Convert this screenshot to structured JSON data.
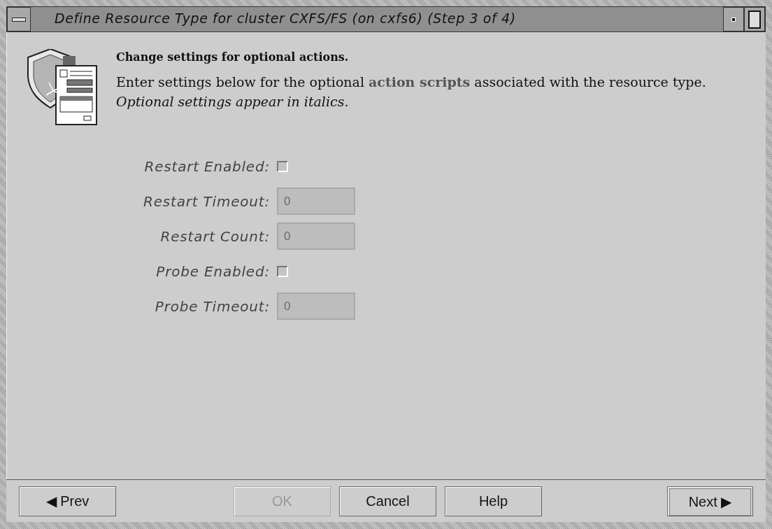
{
  "window": {
    "title": "Define Resource Type for cluster CXFS/FS (on cxfs6) (Step 3 of 4)"
  },
  "header": {
    "heading": "Change settings for optional actions.",
    "text": "Enter settings below for the optional **action scripts** associated with the resource type.  *Optional settings appear in italics.*"
  },
  "fields": [
    {
      "kind": "checkbox",
      "label": "Restart Enabled:",
      "checked": false,
      "disabled": true
    },
    {
      "kind": "text",
      "label": "Restart Timeout:",
      "value": "0",
      "disabled": true
    },
    {
      "kind": "text",
      "label": "Restart Count:",
      "value": "0",
      "disabled": true
    },
    {
      "kind": "checkbox",
      "label": "Probe Enabled:",
      "checked": false,
      "disabled": true
    },
    {
      "kind": "text",
      "label": "Probe Timeout:",
      "value": "0",
      "disabled": true
    }
  ],
  "buttons": [
    {
      "label": "Prev",
      "icon": "◀",
      "disabled": false,
      "focused": false
    },
    {
      "label": "OK",
      "disabled": true,
      "focused": false
    },
    {
      "label": "Cancel",
      "disabled": false,
      "focused": false
    },
    {
      "label": "Help",
      "disabled": false,
      "focused": false
    },
    {
      "label": "Next",
      "icon": "▶",
      "disabled": false,
      "focused": true
    }
  ]
}
